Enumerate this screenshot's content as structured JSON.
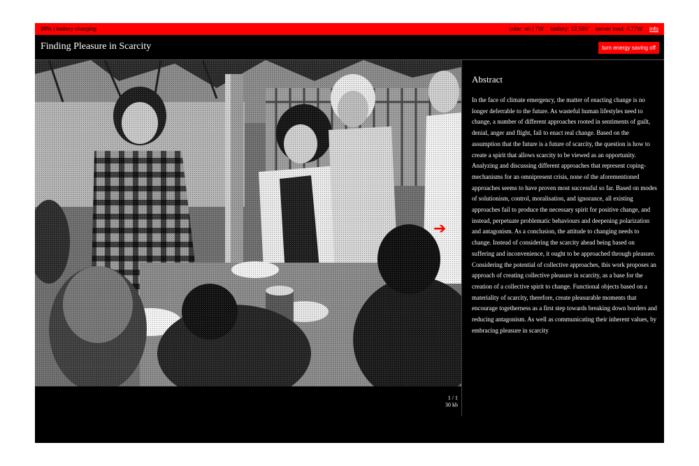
{
  "status": {
    "left_text": "99% | battery charging",
    "solar": "solar: on | 7W",
    "battery": "battery: 12.56V",
    "server_load": "server load: 4.77W",
    "info_link": "info"
  },
  "header": {
    "title": "Finding Pleasure in Scarcity",
    "energy_button": "turn energy saving off"
  },
  "gallery": {
    "page_indicator": "1 / 1",
    "file_size": "30 kb",
    "next_icon": "right-arrow-icon"
  },
  "abstract": {
    "heading": "Abstract",
    "paragraph_1": "In the face of climate emergency, the matter of enacting change is no longer deferrable to the future. As wasteful human lifestyles need to change, a number of different approaches rooted in sentiments of guilt, denial, anger and flight, fail to enact real change. Based on the assumption that the future is a future of scarcity, the question is how to create a spirit that allows scarcity to be viewed as an opportunity. Analyzing and discussing different approaches that represent coping-mechanisms for an omnipresent crisis, none of the aforementioned approaches seems to have proven most successful so far. Based on modes of solutionism, control, moralisation, and ignorance, all existing approaches fail to produce the necessary spirit for positive change, and instead, perpetuate problematic behaviours and deepening polarization and antagonism. As a conclusion, the attitude to changing needs to change. Instead of considering the scarcity ahead being based on suffering and inconvenience, it ought to be approached through pleasure.",
    "paragraph_2": "Considering the potential of collective approaches, this work proposes an approach of creating collective pleasure in scarcity, as a base for the creation of a collective spirit to change. Functional objects based on a materiality of scarcity, therefore, create pleasurable moments that encourage togetherness as a first step towards breaking down borders and reducing antagonism. As well as communicating their inherent values, by embracing pleasure in scarcity"
  },
  "colors": {
    "accent": "#ff0000",
    "background": "#000000",
    "text": "#ffffff"
  }
}
